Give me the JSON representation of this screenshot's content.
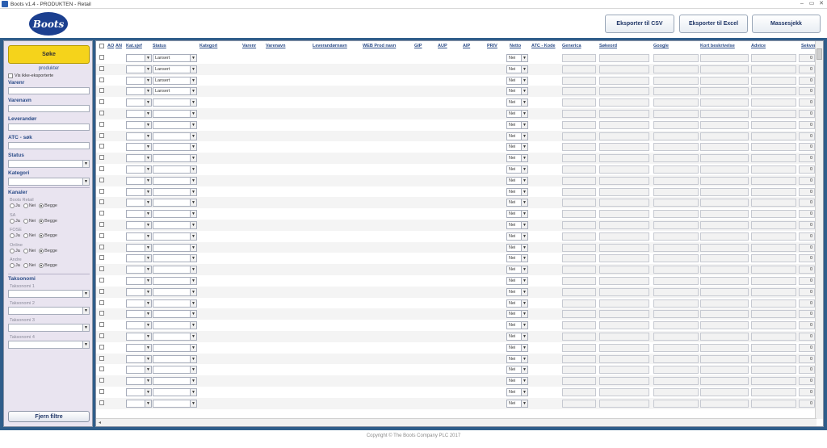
{
  "window": {
    "title": "Boots v1.4 - PRODUKTEN - Retail",
    "controls": [
      "–",
      "▭",
      "✕"
    ]
  },
  "header": {
    "logo_text": "Boots",
    "buttons": {
      "export_csv": "Eksporter til CSV",
      "export_excel": "Eksporter til Excel",
      "mass_check": "Massesjekk"
    }
  },
  "sidebar": {
    "search_button": "Søke",
    "products_label": "produkter",
    "show_non_exported": "Vis ikke-eksporterte",
    "fields": {
      "varenr": "Varenr",
      "varenavn": "Varenavn",
      "leverandor": "Leverandør",
      "atc": "ATC - søk",
      "status": "Status",
      "kategori": "Kategori"
    },
    "channels": {
      "label": "Kanaler",
      "ja": "Ja",
      "nei": "Nei",
      "begge": "Begge",
      "items": [
        "Boots Retail",
        "SA",
        "FOSE",
        "Online",
        "Andre"
      ]
    },
    "taxonomy": {
      "label": "Taksonomi",
      "items": [
        "Taksonomi 1",
        "Taksonomi 2",
        "Taksonomi 3",
        "Taksonomi 4"
      ]
    },
    "clear_button": "Fjern filtre"
  },
  "grid": {
    "columns": {
      "ao": "AO",
      "an": "AN",
      "kat_sjef": "Kat.sjef",
      "status": "Status",
      "kategori": "Kategori",
      "varenr": "Varenr",
      "varenavn": "Varenavn",
      "leverandor": "Leverandørnavn",
      "web": "WEB Prod navn",
      "gip": "GIP",
      "aup": "AUP",
      "aip": "AIP",
      "priv": "PRIV",
      "netto": "Netto",
      "atc": "ATC - Kode",
      "generica": "Generica",
      "sokeord": "Søkeord",
      "google": "Google",
      "kort": "Kort beskrivelse",
      "advice": "Advice",
      "sekvens": "Sekvens"
    },
    "status_values": [
      "Lansert",
      "Lansert",
      "Lansert",
      "Lansert",
      "",
      "",
      "",
      "",
      "",
      "",
      "",
      "",
      "",
      "",
      "",
      "",
      "",
      "",
      "",
      "",
      "",
      "",
      "",
      "",
      "",
      "",
      "",
      "",
      "",
      "",
      "",
      ""
    ],
    "netto_value": "Nei",
    "seq_value": "0",
    "scroll_left_glyph": "◂"
  },
  "footer": {
    "copyright": "Copyright © The Boots Company PLC 2017"
  }
}
